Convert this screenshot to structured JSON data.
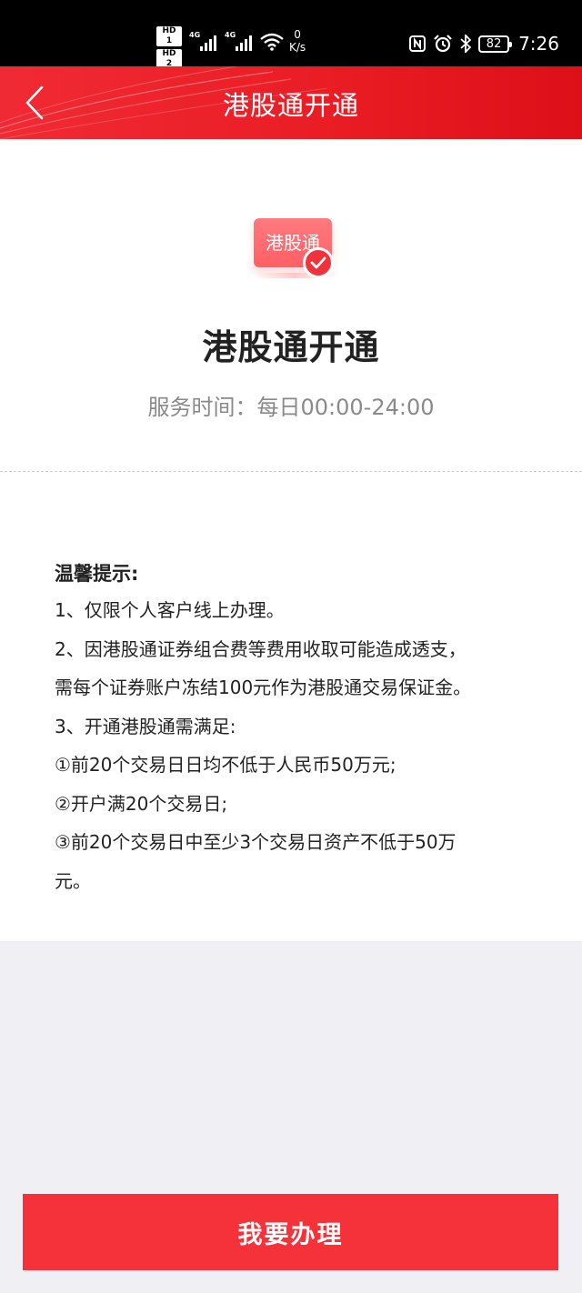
{
  "status_bar": {
    "sim1": "HD 1",
    "sim2": "HD 2",
    "net1": "4G",
    "net2": "4G",
    "speed_value": "0",
    "speed_unit": "K/s",
    "battery": "82",
    "time": "7:26"
  },
  "header": {
    "title": "港股通开通"
  },
  "intro": {
    "icon_text": "港股通",
    "title": "港股通开通",
    "service_time": "服务时间：每日00:00-24:00"
  },
  "tips": {
    "title": "温馨提示:",
    "lines": [
      "1、仅限个人客户线上办理。",
      "2、因港股通证券组合费等费用收取可能造成透支，",
      "需每个证券账户冻结100元作为港股通交易保证金。",
      "3、开通港股通需满足:",
      "①前20个交易日日均不低于人民币50万元;",
      "②开户满20个交易日;",
      "③前20个交易日中至少3个交易日资产不低于50万",
      "元。"
    ]
  },
  "action": {
    "apply_label": "我要办理"
  },
  "colors": {
    "brand_red": "#f5323a",
    "page_bg": "#efeff4",
    "secondary_text": "#8a8a8a"
  }
}
